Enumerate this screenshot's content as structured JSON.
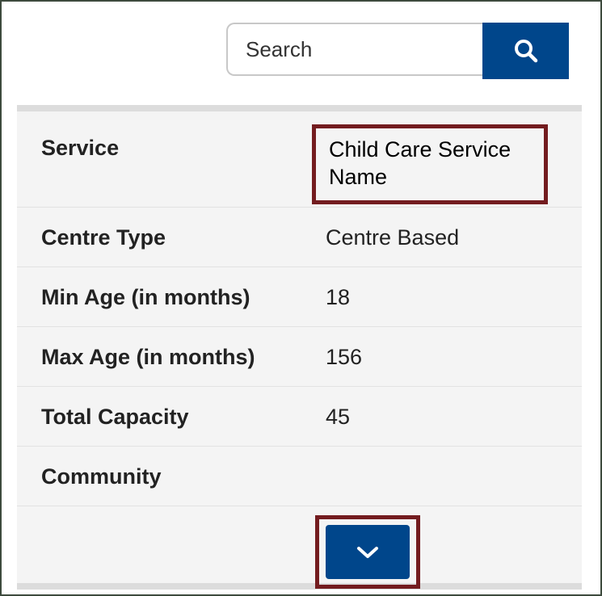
{
  "search": {
    "placeholder": "Search",
    "button_icon": "search-icon",
    "button_color": "#00468b"
  },
  "details": {
    "rows": [
      {
        "label": "Service",
        "value": "Child Care Service Name"
      },
      {
        "label": "Centre Type",
        "value": "Centre Based"
      },
      {
        "label": "Min Age (in months)",
        "value": "18"
      },
      {
        "label": "Max Age (in months)",
        "value": "156"
      },
      {
        "label": "Total Capacity",
        "value": "45"
      },
      {
        "label": "Community",
        "value": ""
      }
    ]
  },
  "expand_button": {
    "icon": "chevron-down-icon",
    "color": "#00468b"
  },
  "highlight_color": "#731c1f"
}
